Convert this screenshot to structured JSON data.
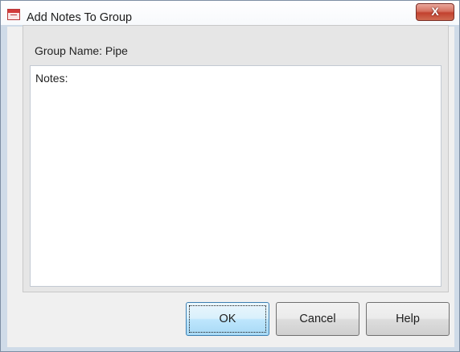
{
  "window": {
    "title": "Add Notes To Group",
    "close_label": "X"
  },
  "main": {
    "group_name_label": "Group Name: Pipe",
    "notes_label": "Notes:"
  },
  "buttons": {
    "ok": "OK",
    "cancel": "Cancel",
    "help": "Help"
  }
}
